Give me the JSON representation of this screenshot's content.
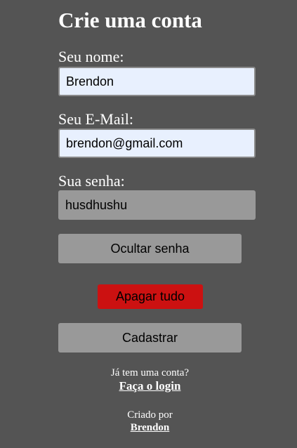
{
  "title": "Crie uma conta",
  "name": {
    "label": "Seu nome:",
    "value": "Brendon"
  },
  "email": {
    "label": "Seu E-Mail:",
    "value": "brendon@gmail.com"
  },
  "password": {
    "label": "Sua senha:",
    "value": "husdhushu"
  },
  "buttons": {
    "toggle_password": "Ocultar senha",
    "clear_all": "Apagar tudo",
    "submit": "Cadastrar"
  },
  "login_prompt": {
    "text": "Já tem uma conta?",
    "link": "Faça o login"
  },
  "credits": {
    "text": "Criado por",
    "author": "Brendon"
  },
  "colors": {
    "background": "#545454",
    "input_autofill": "#e8f0fe",
    "input_plain": "#999999",
    "button_gray": "#999999",
    "button_red": "#cc1111"
  }
}
